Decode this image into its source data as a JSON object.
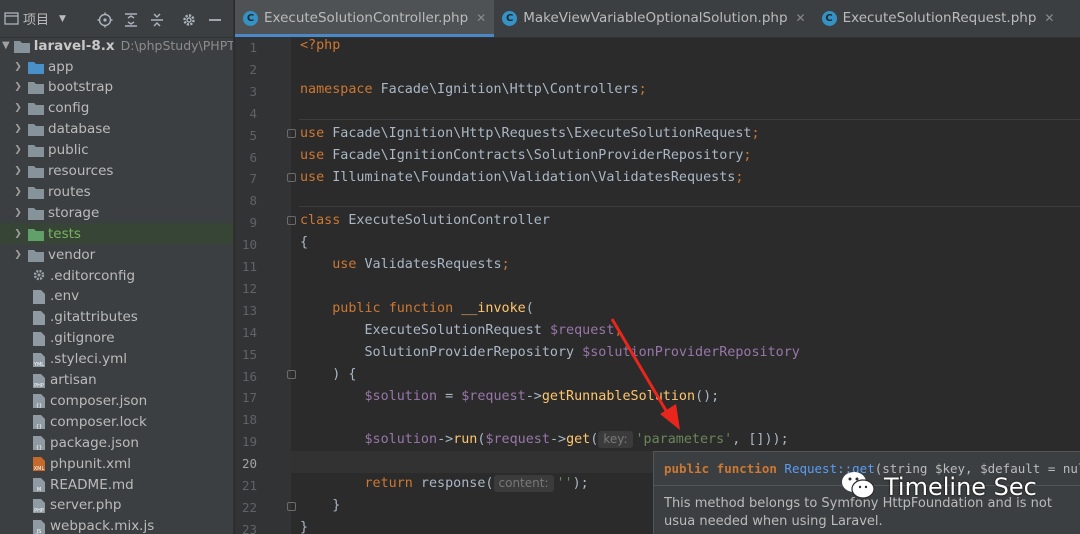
{
  "project": {
    "title": "项目",
    "root_name": "laravel-8.x",
    "root_path": "D:\\phpStudy\\PHPTuto",
    "items": [
      {
        "name": "app",
        "type": "folder"
      },
      {
        "name": "bootstrap",
        "type": "folder"
      },
      {
        "name": "config",
        "type": "folder"
      },
      {
        "name": "database",
        "type": "folder"
      },
      {
        "name": "public",
        "type": "folder"
      },
      {
        "name": "resources",
        "type": "folder"
      },
      {
        "name": "routes",
        "type": "folder"
      },
      {
        "name": "storage",
        "type": "folder"
      },
      {
        "name": "tests",
        "type": "folder"
      },
      {
        "name": "vendor",
        "type": "folder"
      },
      {
        "name": ".editorconfig",
        "type": "config"
      },
      {
        "name": ".env",
        "type": "text"
      },
      {
        "name": ".gitattributes",
        "type": "text"
      },
      {
        "name": ".gitignore",
        "type": "text"
      },
      {
        "name": ".styleci.yml",
        "type": "yml"
      },
      {
        "name": "artisan",
        "type": "php"
      },
      {
        "name": "composer.json",
        "type": "json"
      },
      {
        "name": "composer.lock",
        "type": "json"
      },
      {
        "name": "package.json",
        "type": "json"
      },
      {
        "name": "phpunit.xml",
        "type": "xml"
      },
      {
        "name": "README.md",
        "type": "md"
      },
      {
        "name": "server.php",
        "type": "php"
      },
      {
        "name": "webpack.mix.js",
        "type": "js"
      }
    ]
  },
  "tabs": [
    {
      "label": "ExecuteSolutionController.php",
      "icon_letter": "C",
      "active": true
    },
    {
      "label": "MakeViewVariableOptionalSolution.php",
      "icon_letter": "C",
      "active": false
    },
    {
      "label": "ExecuteSolutionRequest.php",
      "icon_letter": "C",
      "active": false
    }
  ],
  "editor": {
    "current_line": 20,
    "lines": [
      {
        "n": "1"
      },
      {
        "n": "2"
      },
      {
        "n": "3"
      },
      {
        "n": "4"
      },
      {
        "n": "5"
      },
      {
        "n": "6"
      },
      {
        "n": "7"
      },
      {
        "n": "8"
      },
      {
        "n": "9"
      },
      {
        "n": "10"
      },
      {
        "n": "11"
      },
      {
        "n": "12"
      },
      {
        "n": "13"
      },
      {
        "n": "14"
      },
      {
        "n": "15"
      },
      {
        "n": "16"
      },
      {
        "n": "17"
      },
      {
        "n": "18"
      },
      {
        "n": "19"
      },
      {
        "n": "20"
      },
      {
        "n": "21"
      },
      {
        "n": "22"
      },
      {
        "n": "23"
      }
    ],
    "tokens": {
      "l1": "<?php",
      "l3_kw": "namespace",
      "l3_ns": " Facade\\Ignition\\Http\\Controllers",
      "l5_kw": "use",
      "l5_ns": " Facade\\Ignition\\Http\\Requests\\ExecuteSolutionRequest",
      "l6_kw": "use",
      "l6_ns": " Facade\\IgnitionContracts\\SolutionProviderRepository",
      "l7_kw": "use",
      "l7_ns": " Illuminate\\Foundation\\Validation\\ValidatesRequests",
      "l9_kw": "class",
      "l9_name": " ExecuteSolutionController",
      "l10": "{",
      "l11_kw": "use",
      "l11_name": " ValidatesRequests",
      "l13_kw1": "public",
      "l13_kw2": "function",
      "l13_fn": "__invoke",
      "l13_paren": "(",
      "l14_type": "ExecuteSolutionRequest",
      "l14_var": "$request",
      "l15_type": "SolutionProviderRepository",
      "l15_var": "$solutionProviderRepository",
      "l16": ") {",
      "l17_var": "$solution",
      "l17_eq": " = ",
      "l17_var2": "$request",
      "l17_arrow": "->",
      "l17_fn": "getRunnableSolution",
      "l17_end": "();",
      "l19_var": "$solution",
      "l19_arrow": "->",
      "l19_fn": "run",
      "l19_p": "(",
      "l19_var2": "$request",
      "l19_arrow2": "->",
      "l19_fn2": "get",
      "l19_p2": "(",
      "l19_hint": "key:",
      "l19_str": "'parameters'",
      "l19_end": ", []));",
      "l21_kw": "return",
      "l21_fn": " response(",
      "l21_hint": "content:",
      "l21_str": "''",
      "l21_end": ");",
      "l22": "}",
      "l23": "}"
    }
  },
  "doc_popup": {
    "sig_prefix": "public function ",
    "sig_link": "Request::get",
    "sig_rest": "(string $key, $default = nul",
    "body": "This method belongs to Symfony HttpFoundation and is not usua needed when using Laravel."
  },
  "watermark": {
    "text": "Timeline Sec"
  },
  "colors": {
    "keyword": "#cc7832",
    "variable": "#9876aa",
    "string": "#6a8759",
    "function": "#ffc66d",
    "arrow": "#e8261c"
  }
}
